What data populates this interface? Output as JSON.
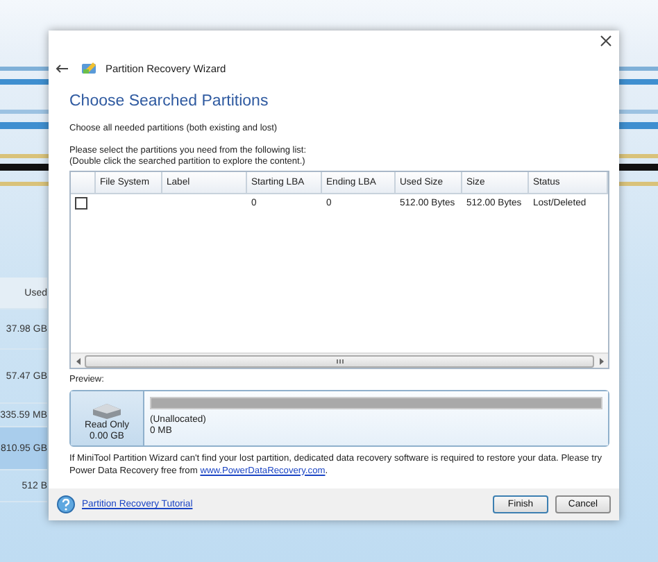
{
  "background_app": {
    "column_header": "Used",
    "values": [
      "37.98 GB",
      "57.47 GB",
      "335.59 MB",
      "810.95 GB",
      "512 B"
    ]
  },
  "dialog": {
    "title": "Partition Recovery Wizard",
    "heading": "Choose Searched Partitions",
    "subtitle": "Choose all needed partitions (both existing and lost)",
    "instructions": [
      "Please select the partitions you need from the following list:",
      "(Double click the searched partition to explore the content.)"
    ],
    "table": {
      "columns": [
        "File System",
        "Label",
        "Starting LBA",
        "Ending LBA",
        "Used Size",
        "Size",
        "Status"
      ],
      "rows": [
        {
          "checked": false,
          "cells": [
            "",
            "",
            "0",
            "0",
            "512.00 Bytes",
            "512.00 Bytes",
            "Lost/Deleted"
          ]
        }
      ]
    },
    "preview": {
      "label": "Preview:",
      "disk": {
        "mode": "Read Only",
        "capacity": "0.00 GB"
      },
      "partition": {
        "name": "(Unallocated)",
        "size": "0 MB"
      }
    },
    "note": {
      "text": "If MiniTool Partition Wizard can't find your lost partition, dedicated data recovery software is required to restore your data. Please try Power Data Recovery free from",
      "link": "www.PowerDataRecovery.com",
      "end": "."
    },
    "footer": {
      "help_link": "Partition Recovery Tutorial",
      "buttons": [
        "Finish",
        "Cancel"
      ]
    }
  }
}
